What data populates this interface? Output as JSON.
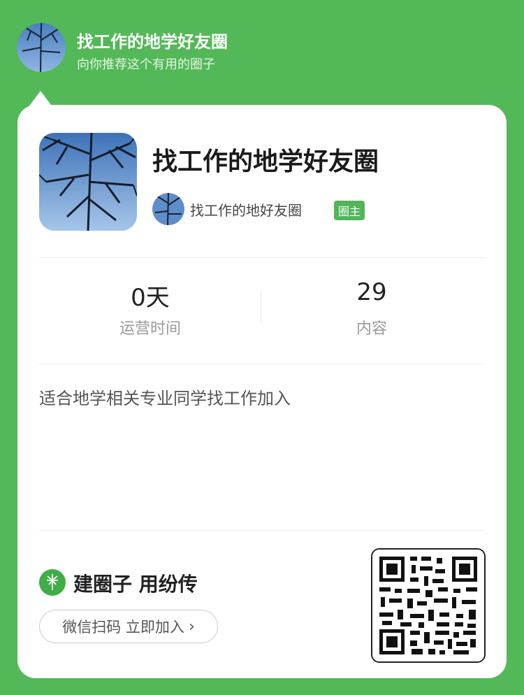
{
  "header": {
    "title": "找工作的地学好友圈",
    "subtitle": "向你推荐这个有用的圈子"
  },
  "circle": {
    "title": "找工作的地学好友圈",
    "owner_name": "找工作的地好友圈",
    "owner_badge": "圈主"
  },
  "stats": [
    {
      "value": "0天",
      "label": "运营时间"
    },
    {
      "value": "29",
      "label": "内容"
    }
  ],
  "description": "适合地学相关专业同学找工作加入",
  "footer": {
    "brand": "建圈子 用纷传",
    "join_label": "微信扫码 立即加入",
    "chevron": "›"
  },
  "colors": {
    "background": "#53b857",
    "accent": "#52b55a",
    "card": "#ffffff"
  },
  "icons": [
    "tree-avatar-icon",
    "dandelion-icon",
    "chevron-right-icon",
    "qr-code-icon"
  ]
}
